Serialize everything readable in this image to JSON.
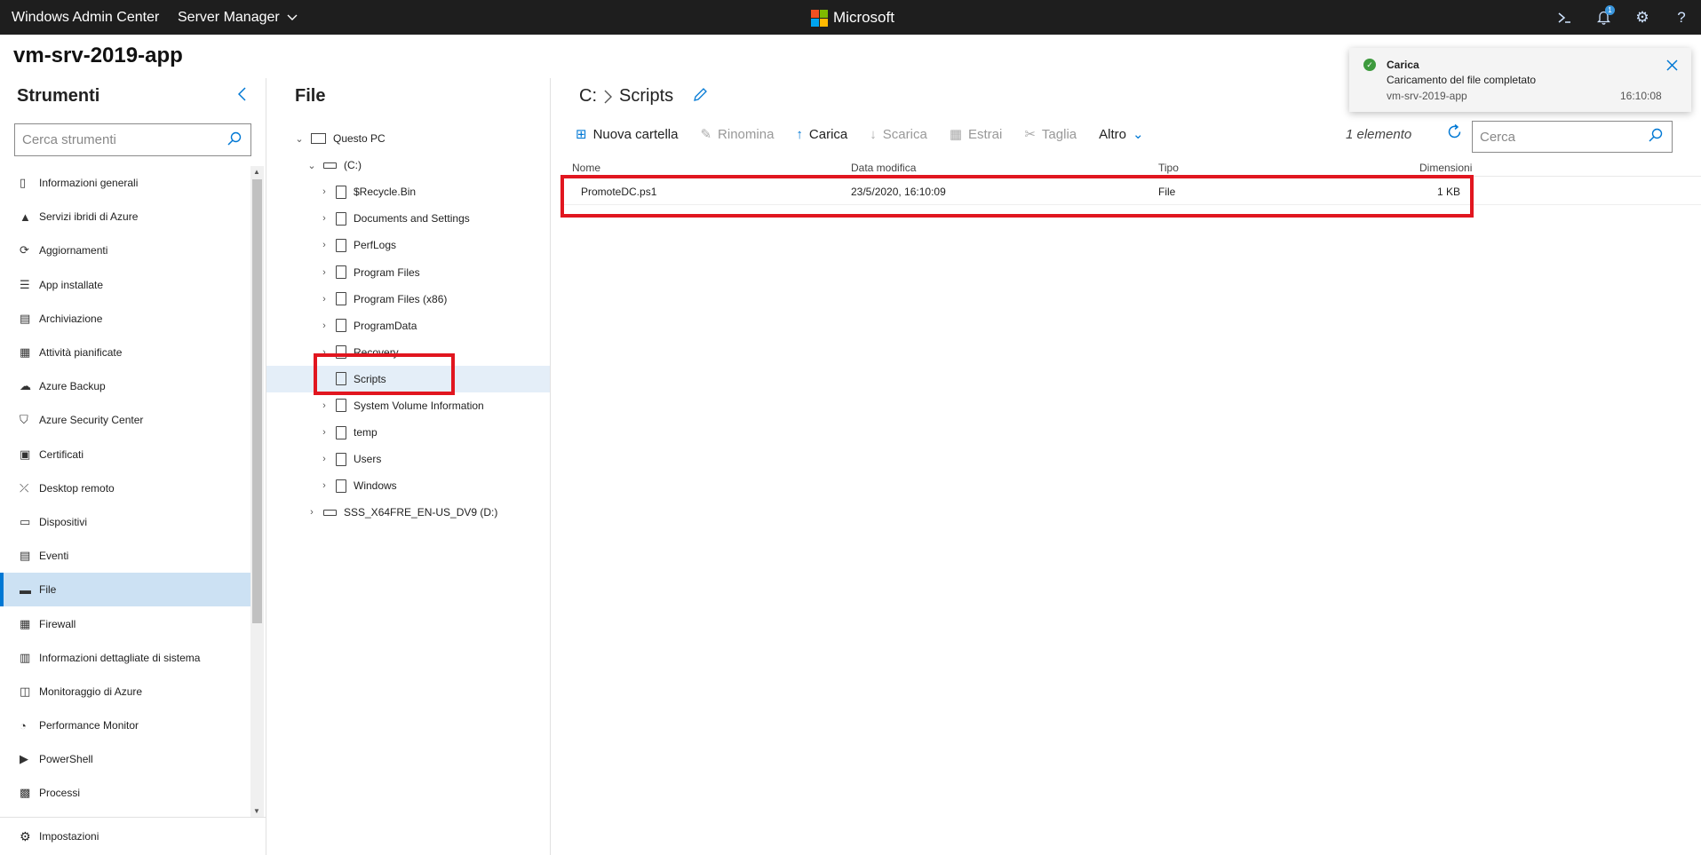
{
  "header": {
    "app_title": "Windows Admin Center",
    "server_manager": "Server Manager",
    "brand": "Microsoft",
    "brand_colors": [
      "#f25022",
      "#7fba00",
      "#00a4ef",
      "#ffb900"
    ],
    "notification_count": "1",
    "icons": [
      "powershell-icon",
      "bell-icon",
      "gear-icon",
      "help-icon"
    ]
  },
  "server": {
    "name": "vm-srv-2019-app"
  },
  "tools": {
    "title": "Strumenti",
    "search_placeholder": "Cerca strumenti",
    "items": [
      {
        "label": "Informazioni generali",
        "icon": "overview-icon"
      },
      {
        "label": "Servizi ibridi di Azure",
        "icon": "azure-icon"
      },
      {
        "label": "Aggiornamenti",
        "icon": "updates-icon"
      },
      {
        "label": "App installate",
        "icon": "apps-icon"
      },
      {
        "label": "Archiviazione",
        "icon": "storage-icon"
      },
      {
        "label": "Attività pianificate",
        "icon": "scheduled-tasks-icon"
      },
      {
        "label": "Azure Backup",
        "icon": "backup-icon"
      },
      {
        "label": "Azure Security Center",
        "icon": "security-icon"
      },
      {
        "label": "Certificati",
        "icon": "certificate-icon"
      },
      {
        "label": "Desktop remoto",
        "icon": "remote-desktop-icon"
      },
      {
        "label": "Dispositivi",
        "icon": "devices-icon"
      },
      {
        "label": "Eventi",
        "icon": "events-icon"
      },
      {
        "label": "File",
        "icon": "files-icon",
        "active": true
      },
      {
        "label": "Firewall",
        "icon": "firewall-icon"
      },
      {
        "label": "Informazioni dettagliate di sistema",
        "icon": "insights-icon"
      },
      {
        "label": "Monitoraggio di Azure",
        "icon": "monitor-icon"
      },
      {
        "label": "Performance Monitor",
        "icon": "performance-icon"
      },
      {
        "label": "PowerShell",
        "icon": "powershell-icon"
      },
      {
        "label": "Processi",
        "icon": "processes-icon"
      }
    ],
    "settings_label": "Impostazioni"
  },
  "tree": {
    "title": "File",
    "nodes": [
      {
        "label": "Questo PC",
        "level": 0,
        "expanded": true,
        "type": "pc"
      },
      {
        "label": "(C:)",
        "level": 1,
        "expanded": true,
        "type": "drive"
      },
      {
        "label": "$Recycle.Bin",
        "level": 2,
        "type": "folder"
      },
      {
        "label": "Documents and Settings",
        "level": 2,
        "type": "folder"
      },
      {
        "label": "PerfLogs",
        "level": 2,
        "type": "folder"
      },
      {
        "label": "Program Files",
        "level": 2,
        "type": "folder"
      },
      {
        "label": "Program Files (x86)",
        "level": 2,
        "type": "folder"
      },
      {
        "label": "ProgramData",
        "level": 2,
        "type": "folder"
      },
      {
        "label": "Recovery",
        "level": 2,
        "type": "folder"
      },
      {
        "label": "Scripts",
        "level": 2,
        "type": "folder",
        "selected": true,
        "no_children": true
      },
      {
        "label": "System Volume Information",
        "level": 2,
        "type": "folder"
      },
      {
        "label": "temp",
        "level": 2,
        "type": "folder"
      },
      {
        "label": "Users",
        "level": 2,
        "type": "folder"
      },
      {
        "label": "Windows",
        "level": 2,
        "type": "folder"
      },
      {
        "label": "SSS_X64FRE_EN-US_DV9 (D:)",
        "level": 1,
        "type": "drive"
      }
    ]
  },
  "main": {
    "breadcrumb": {
      "drive": "C:",
      "folder": "Scripts"
    },
    "toolbar": [
      {
        "label": "Nuova cartella",
        "icon": "new-folder-icon",
        "enabled": true
      },
      {
        "label": "Rinomina",
        "icon": "rename-icon",
        "enabled": false
      },
      {
        "label": "Carica",
        "icon": "upload-icon",
        "enabled": true
      },
      {
        "label": "Scarica",
        "icon": "download-icon",
        "enabled": false
      },
      {
        "label": "Estrai",
        "icon": "extract-icon",
        "enabled": false
      },
      {
        "label": "Taglia",
        "icon": "cut-icon",
        "enabled": false
      },
      {
        "label": "Altro",
        "icon": "chevron-down-icon",
        "enabled": true,
        "dropdown": true
      }
    ],
    "item_count": "1 elemento",
    "search_placeholder": "Cerca",
    "columns": {
      "name": "Nome",
      "modified": "Data modifica",
      "type": "Tipo",
      "size": "Dimensioni"
    },
    "rows": [
      {
        "name": "PromoteDC.ps1",
        "modified": "23/5/2020, 16:10:09",
        "type": "File",
        "size": "1 KB"
      }
    ]
  },
  "toast": {
    "title": "Carica",
    "message": "Caricamento del file completato",
    "source": "vm-srv-2019-app",
    "time": "16:10:08",
    "status_color": "#3d9a3d"
  },
  "accent_color": "#0078d4",
  "highlight_color": "#e1161f"
}
